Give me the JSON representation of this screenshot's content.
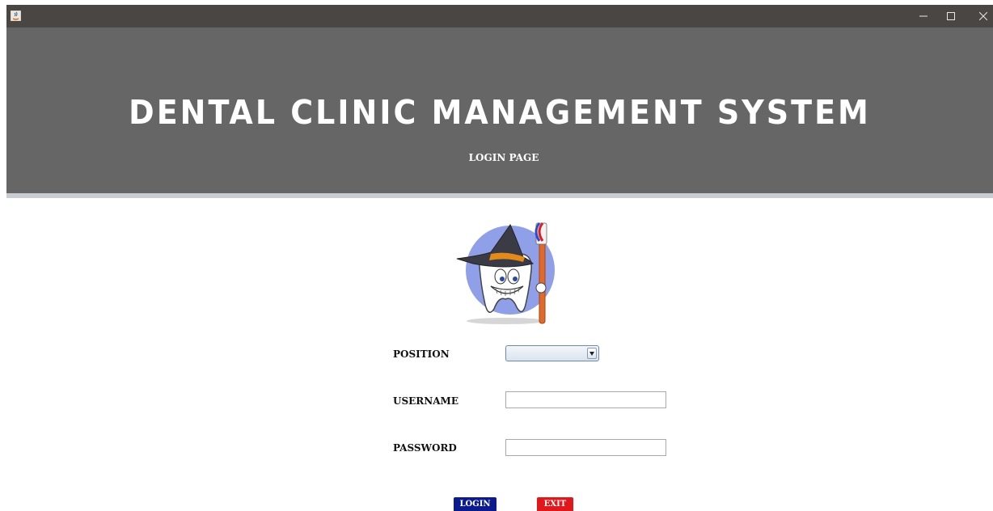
{
  "window": {
    "controls": [
      "minimize",
      "maximize",
      "close"
    ]
  },
  "banner": {
    "title": "DENTAL CLINIC MANAGEMENT SYSTEM",
    "subtitle": "LOGIN PAGE",
    "background": "#666666"
  },
  "form": {
    "position_label": "POSITION",
    "position_selected": "",
    "username_label": "USERNAME",
    "username_value": "",
    "password_label": "PASSWORD",
    "password_value": ""
  },
  "buttons": {
    "login_label": "LOGIN",
    "login_color": "#0b1a8c",
    "exit_label": "EXIT",
    "exit_color": "#e0171b"
  },
  "icons": {
    "app": "java-coffee-icon",
    "mascot": "tooth-wizard-mascot"
  }
}
